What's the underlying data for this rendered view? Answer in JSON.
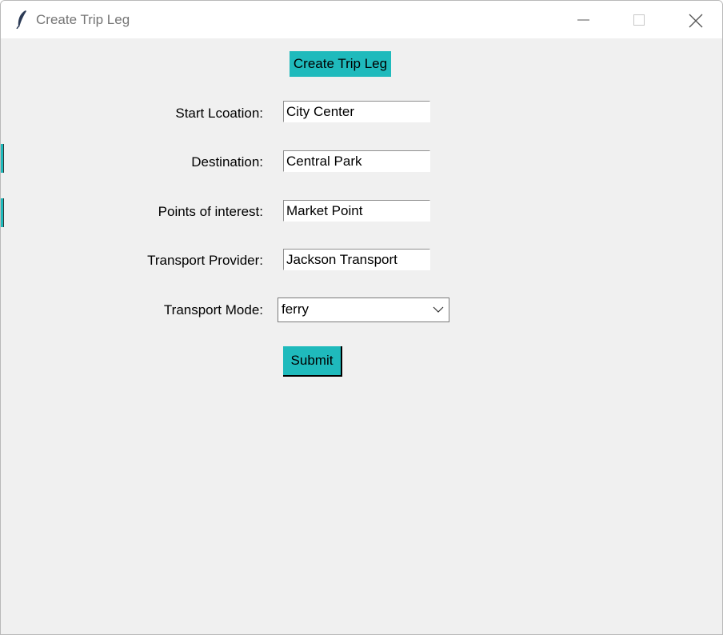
{
  "window": {
    "title": "Create Trip Leg",
    "icon": "feather-icon",
    "controls": [
      "minimize-icon",
      "maximize-icon",
      "close-icon"
    ]
  },
  "heading": "Create Trip Leg",
  "form": {
    "start_location": {
      "label": "Start Lcoation:",
      "value": "City Center"
    },
    "destination": {
      "label": "Destination:",
      "value": "Central Park"
    },
    "points_of_interest": {
      "label": "Points of interest:",
      "value": "Market Point"
    },
    "transport_provider": {
      "label": "Transport Provider:",
      "value": "Jackson Transport"
    },
    "transport_mode": {
      "label": "Transport Mode:",
      "value": "ferry"
    }
  },
  "submit_label": "Submit",
  "colors": {
    "accent": "#1fbabc",
    "background": "#f0f0f0"
  }
}
